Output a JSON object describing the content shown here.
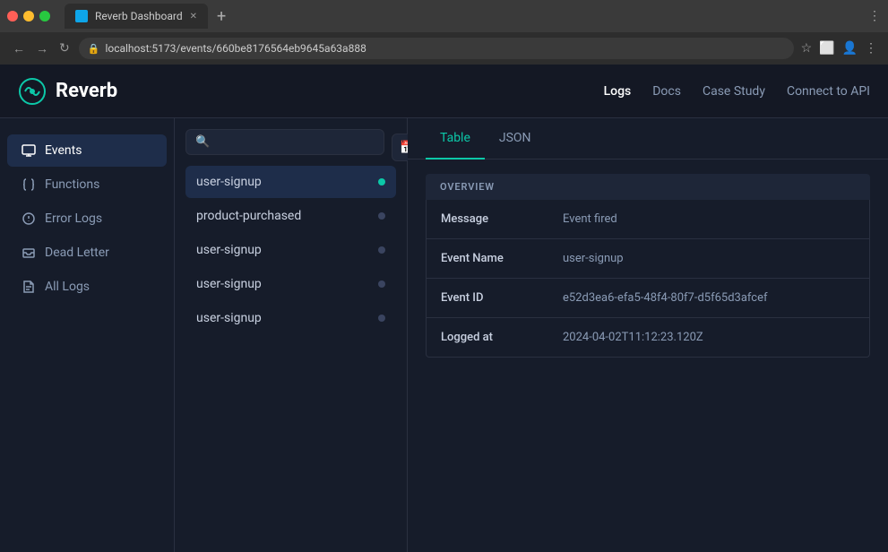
{
  "browser": {
    "tab_title": "Reverb Dashboard",
    "url": "localhost:5173/events/660be8176564eb9645a63a888",
    "new_tab_label": "+",
    "nav_back": "←",
    "nav_forward": "→",
    "nav_reload": "↻",
    "menu_dots": "⋮"
  },
  "topnav": {
    "logo_text": "Reverb",
    "links": [
      {
        "label": "Logs",
        "active": true
      },
      {
        "label": "Docs",
        "active": false
      },
      {
        "label": "Case Study",
        "active": false
      },
      {
        "label": "Connect to API",
        "active": false
      }
    ]
  },
  "sidebar": {
    "items": [
      {
        "id": "events",
        "label": "Events",
        "active": true,
        "icon": "monitor"
      },
      {
        "id": "functions",
        "label": "Functions",
        "active": false,
        "icon": "braces"
      },
      {
        "id": "error-logs",
        "label": "Error Logs",
        "active": false,
        "icon": "alert-circle"
      },
      {
        "id": "dead-letter",
        "label": "Dead Letter",
        "active": false,
        "icon": "inbox"
      },
      {
        "id": "all-logs",
        "label": "All Logs",
        "active": false,
        "icon": "file-text"
      }
    ]
  },
  "event_list": {
    "search_placeholder": "",
    "events": [
      {
        "name": "user-signup",
        "active": true
      },
      {
        "name": "product-purchased",
        "active": false
      },
      {
        "name": "user-signup",
        "active": false
      },
      {
        "name": "user-signup",
        "active": false
      },
      {
        "name": "user-signup",
        "active": false
      }
    ]
  },
  "detail": {
    "tabs": [
      {
        "label": "Table",
        "active": true
      },
      {
        "label": "JSON",
        "active": false
      }
    ],
    "overview_header": "OVERVIEW",
    "rows": [
      {
        "key": "Message",
        "value": "Event fired"
      },
      {
        "key": "Event Name",
        "value": "user-signup"
      },
      {
        "key": "Event ID",
        "value": "e52d3ea6-efa5-48f4-80f7-d5f65d3afcef"
      },
      {
        "key": "Logged at",
        "value": "2024-04-02T11:12:23.120Z"
      }
    ]
  }
}
